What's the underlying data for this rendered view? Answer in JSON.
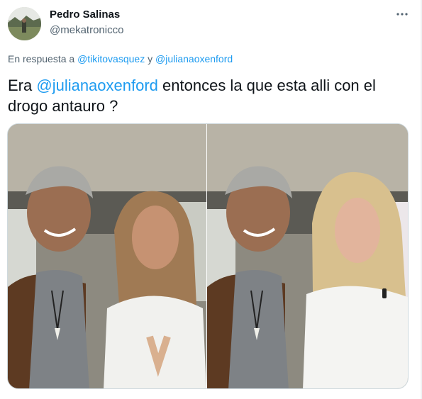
{
  "author": {
    "name": "Pedro Salinas",
    "handle": "@mekatronicco"
  },
  "reply": {
    "prefix": "En respuesta a ",
    "user1": "@tikitovasquez",
    "separator": " y ",
    "user2": "@julianaoxenford"
  },
  "tweet": {
    "before": "Era ",
    "mention": "@julianaoxenford",
    "after": "  entonces la que esta alli con el drogo antauro ?"
  },
  "media": {
    "photo1": "original-photo",
    "photo2": "edited-photo"
  },
  "colors": {
    "link": "#1d9bf0",
    "secondary_text": "#536471",
    "primary_text": "#0f1419"
  },
  "icons": {
    "more": "more-icon"
  }
}
